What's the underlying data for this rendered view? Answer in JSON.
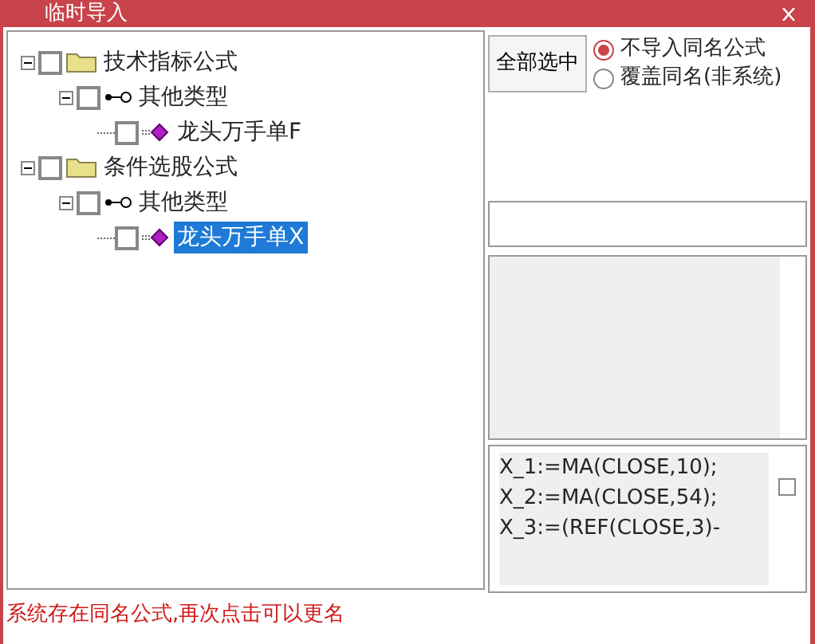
{
  "window": {
    "title": "临时导入"
  },
  "tree": [
    {
      "kind": "folder",
      "label": "技术指标公式",
      "checked": false,
      "expanded": true,
      "selected": false,
      "children": [
        {
          "kind": "category",
          "label": "其他类型",
          "checked": false,
          "expanded": true,
          "selected": false,
          "children": [
            {
              "kind": "formula",
              "label": "龙头万手单F",
              "checked": false,
              "selected": false
            }
          ]
        }
      ]
    },
    {
      "kind": "folder",
      "label": "条件选股公式",
      "checked": false,
      "expanded": true,
      "selected": false,
      "children": [
        {
          "kind": "category",
          "label": "其他类型",
          "checked": false,
          "expanded": true,
          "selected": false,
          "children": [
            {
              "kind": "formula",
              "label": "龙头万手单X",
              "checked": false,
              "selected": true
            }
          ]
        }
      ]
    }
  ],
  "select_all_button": "全部选中",
  "options": [
    {
      "label": "不导入同名公式",
      "selected": true
    },
    {
      "label": "覆盖同名(非系统)",
      "selected": false
    }
  ],
  "formula_text": {
    "lines": [
      "X_1:=MA(CLOSE,10);",
      "X_2:=MA(CLOSE,54);",
      "X_3:=(REF(CLOSE,3)-"
    ],
    "checked": false
  },
  "status": "系统存在同名公式,再次点击可以更名"
}
